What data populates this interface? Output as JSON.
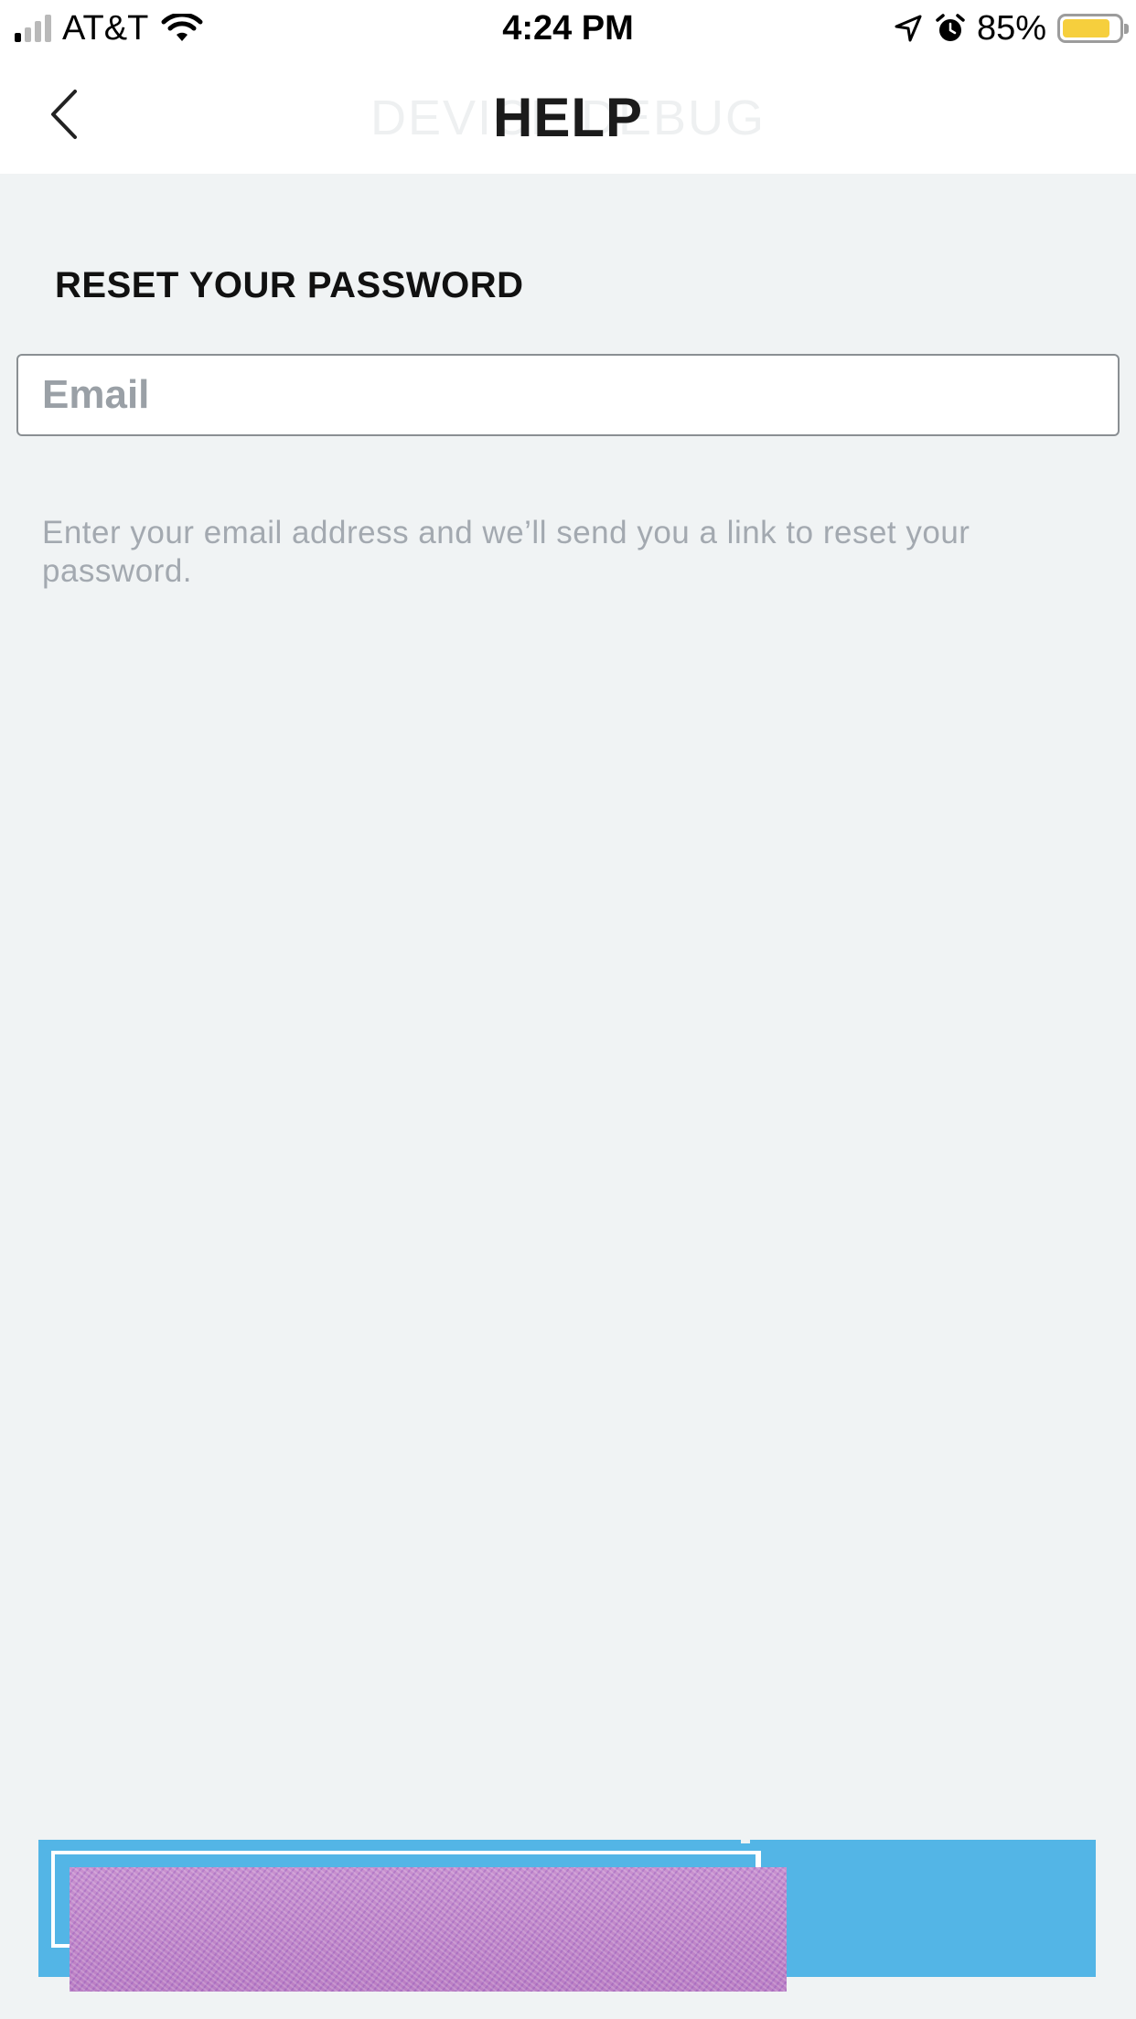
{
  "status_bar": {
    "carrier": "AT&T",
    "time": "4:24 PM",
    "battery_percent": "85%",
    "battery_level": 0.85,
    "signal_bars": 4,
    "signal_bars_active": 1,
    "icons": [
      "signal-icon",
      "wifi-icon",
      "location-arrow-icon",
      "alarm-clock-icon",
      "battery-icon"
    ]
  },
  "nav": {
    "back_icon": "chevron-left-icon",
    "ghost_title": "DEVICE DEBUG",
    "title": "HELP"
  },
  "form": {
    "heading": "RESET YOUR PASSWORD",
    "email_placeholder": "Email",
    "email_value": "",
    "helper_text": "Enter your email address and we’ll send you a link to reset your password."
  },
  "colors": {
    "background": "#f0f3f4",
    "button": "#53b5e6",
    "battery": "#f6cf3d"
  }
}
